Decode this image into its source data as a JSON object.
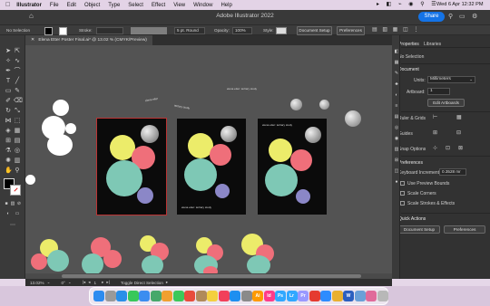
{
  "menubar": {
    "app_name": "Illustrator",
    "items": [
      "File",
      "Edit",
      "Object",
      "Type",
      "Select",
      "Effect",
      "View",
      "Window",
      "Help"
    ],
    "clock": "Wed 6 Apr  12:32 PM"
  },
  "appbar": {
    "title": "Adobe Illustrator 2022",
    "share_label": "Share"
  },
  "control": {
    "selection": "No Selection",
    "stroke_label": "Stroke:",
    "brush_value": "5 pt. Round",
    "opacity_label": "Opacity:",
    "opacity_value": "100%",
    "style_label": "Style:",
    "document_setup": "Document Setup",
    "preferences": "Preferences"
  },
  "tab": {
    "title": "Elena Etter Poster Final.ai* @ 13.02 % (CMYK/Preview)"
  },
  "canvas": {
    "curved_text_1": "elena etter",
    "curved_text_2": "tertiary study",
    "top_text": "elena etter: tertiary study",
    "artboard2_text": "elena etter: tertiary study",
    "artboard3_text": "elena etter: tertiary study"
  },
  "panel": {
    "tabs": [
      "Properties",
      "Libraries"
    ],
    "selection": "No Selection",
    "document_head": "Document",
    "units_label": "Units:",
    "units_value": "Millimeters",
    "artboard_label": "Artboard:",
    "artboard_value": "1",
    "edit_artboards": "Edit Artboards",
    "rulers_label": "Ruler & Grids",
    "guides_label": "Guides",
    "snap_label": "Snap Options",
    "preferences_head": "Preferences",
    "keyboard_increment_label": "Keyboard Increment:",
    "keyboard_increment_value": "0.3528 mr",
    "checks": [
      "Use Preview Bounds",
      "Scale Corners",
      "Scale Strokes & Effects"
    ],
    "quick_actions_head": "Quick Actions",
    "document_setup": "Document Setup",
    "preferences_btn": "Preferences"
  },
  "status": {
    "zoom": "13.02%",
    "rotation": "0°",
    "artboard": "1",
    "tool": "Toggle Direct Selection"
  },
  "dock": {
    "apps": [
      "finder-icon",
      "launchpad-icon",
      "safari-icon",
      "messages-icon",
      "mail-icon",
      "maps-icon",
      "photos-icon",
      "facetime-icon",
      "calendar-icon",
      "contacts-icon",
      "notes-icon",
      "music-icon",
      "appstore-icon",
      "systemprefs-icon",
      "ai-icon",
      "id-icon",
      "ps-icon",
      "lr-icon",
      "pr-icon",
      "acrobat-icon",
      "zoom-icon",
      "chrome-icon",
      "word-icon",
      "preview-icon",
      "photos2-icon",
      "trash-icon"
    ],
    "labels": [
      "",
      "",
      "",
      "",
      "",
      "",
      "",
      "",
      "",
      "",
      "",
      "",
      "",
      "",
      "Ai",
      "Id",
      "Ps",
      "Lr",
      "Pr",
      "",
      "",
      "",
      "W",
      "",
      "",
      ""
    ],
    "colors": [
      "#2d8cf0",
      "#9a9a9a",
      "#2a8fe8",
      "#38c85a",
      "#3b8df0",
      "#46a86a",
      "#f0a030",
      "#3cc85a",
      "#e84c3c",
      "#b08a5a",
      "#f4d03f",
      "#f2405a",
      "#1e8ff0",
      "#8a8a8a",
      "#ff9a00",
      "#fe3b8a",
      "#31a8ff",
      "#31a8ff",
      "#9999ff",
      "#e53b30",
      "#2d8cff",
      "#e8b030",
      "#2b5fbf",
      "#6aa0d8",
      "#e06a9a",
      "#b8b8b8"
    ]
  }
}
